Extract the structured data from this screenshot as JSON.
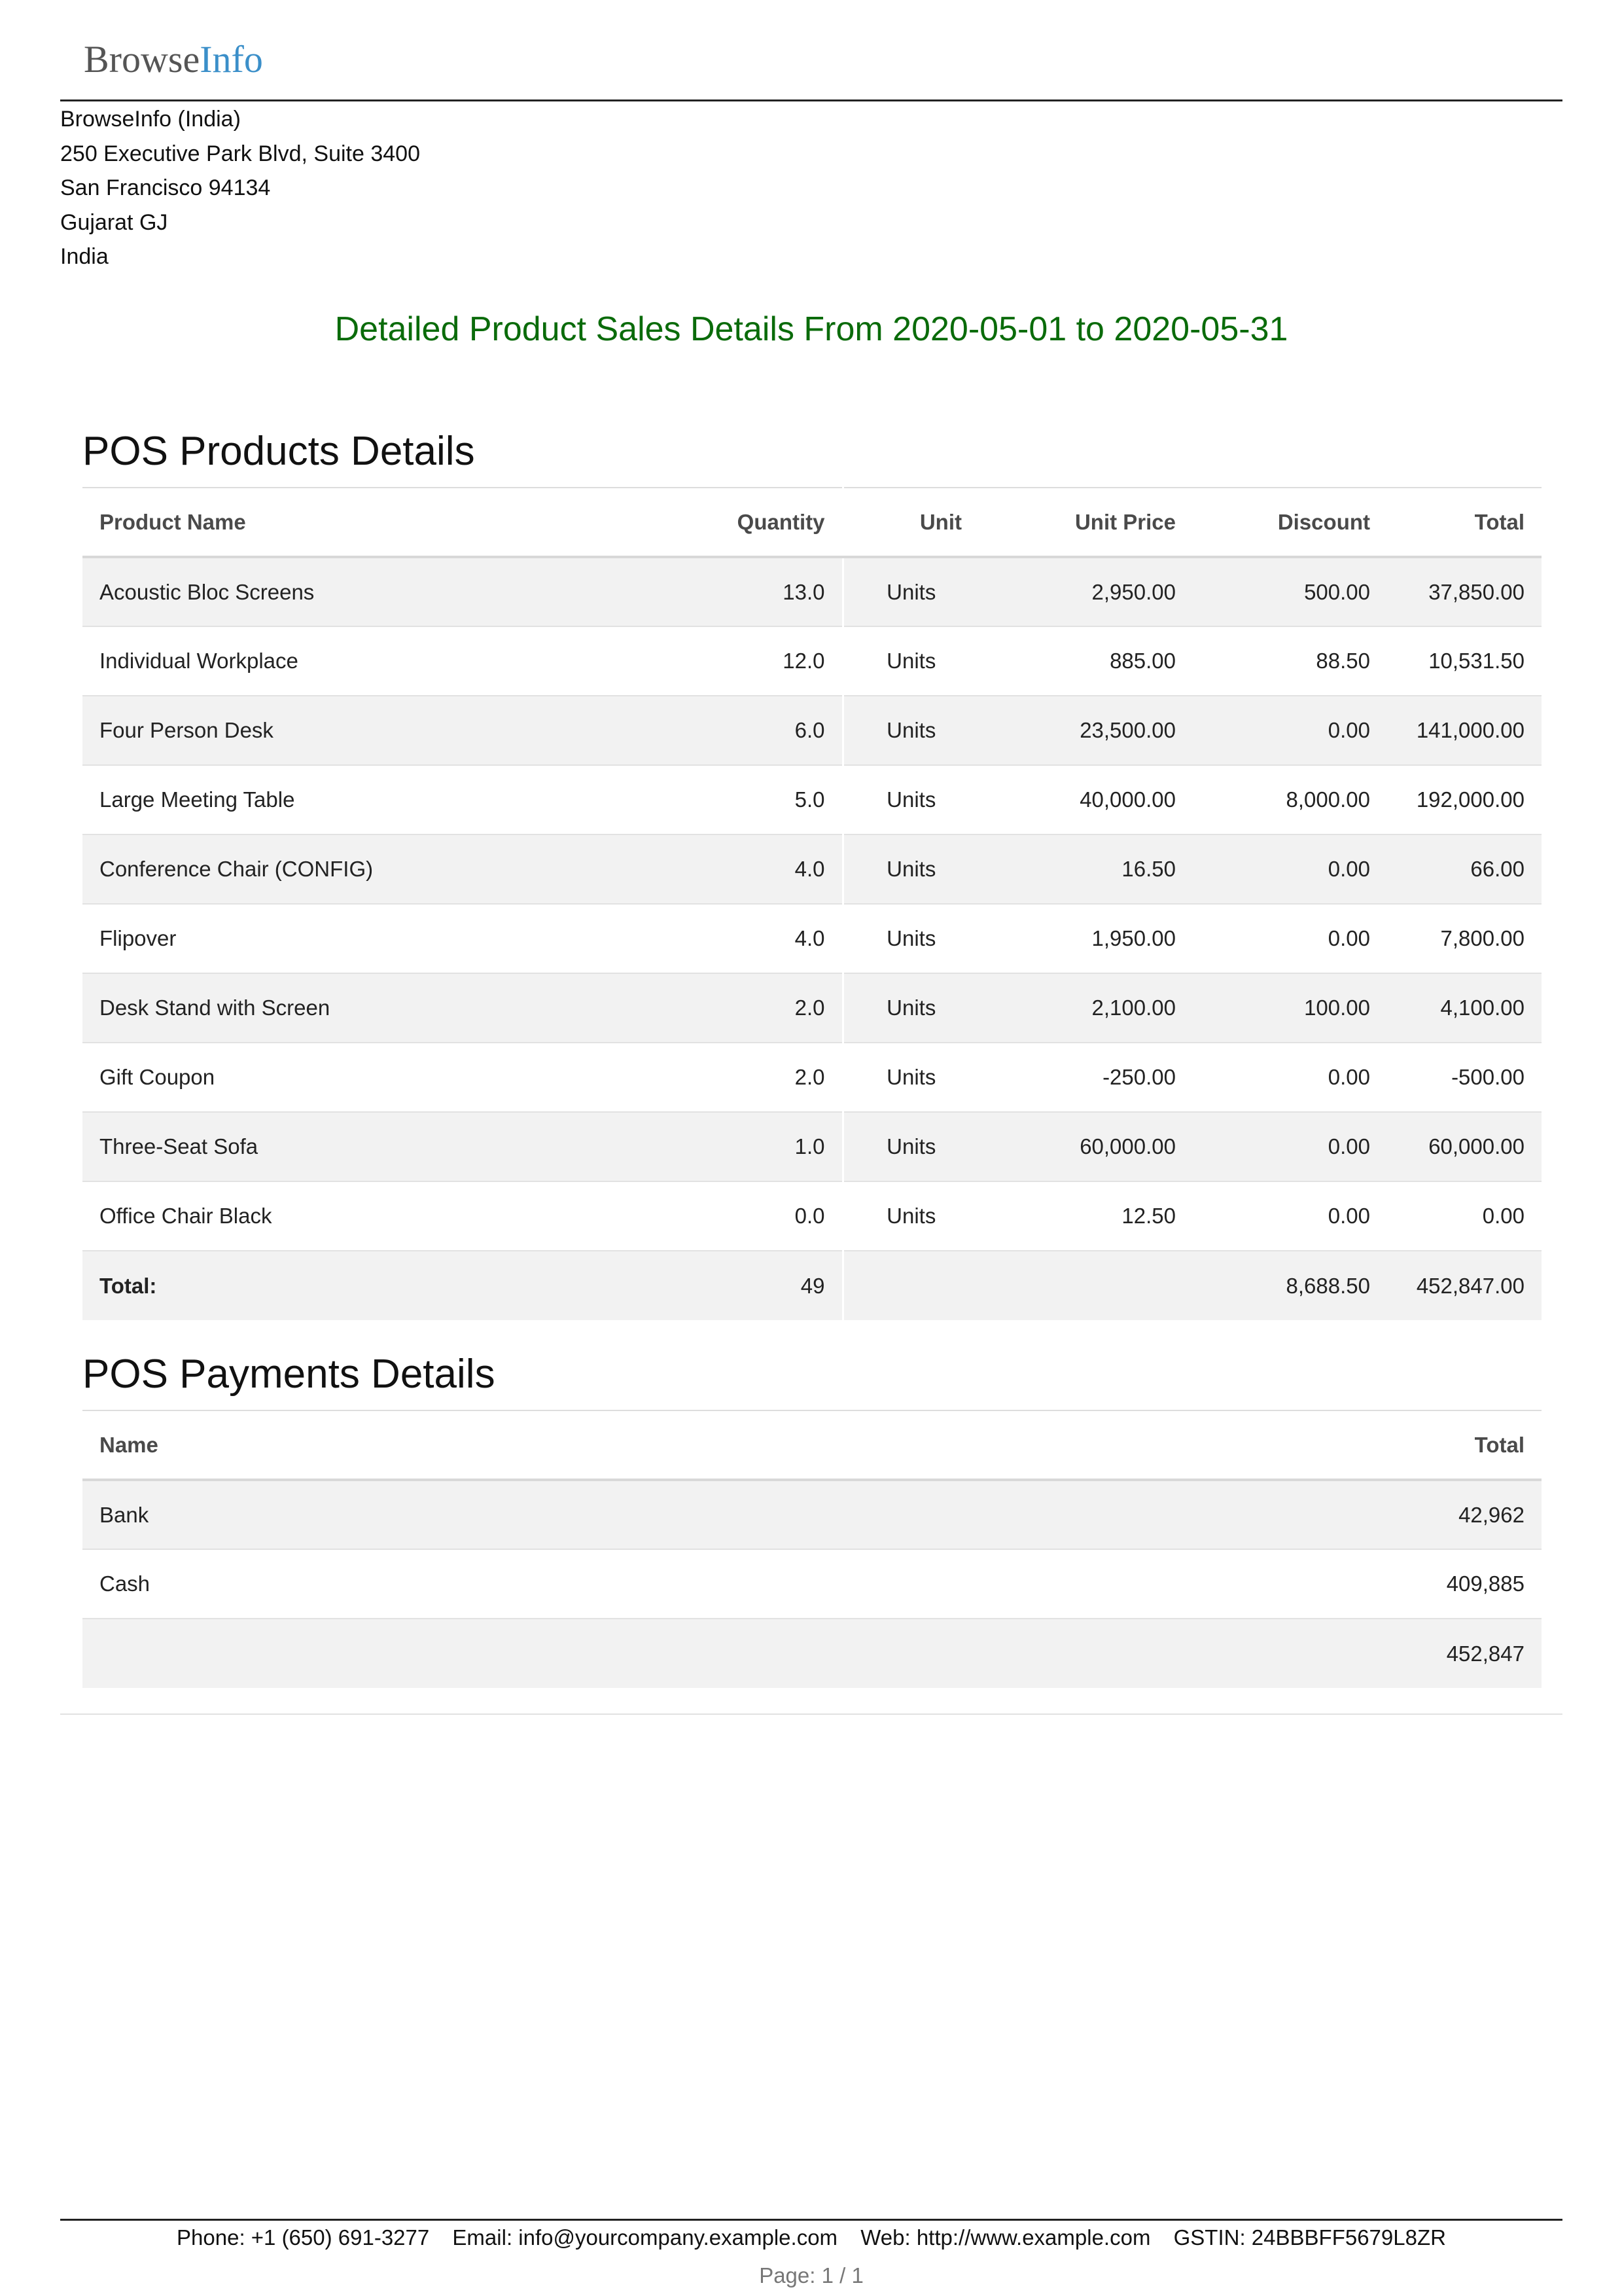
{
  "company": {
    "logo_part1": "Browse",
    "logo_part2": "Info",
    "address_lines": [
      "BrowseInfo (India)",
      "250 Executive Park Blvd, Suite 3400",
      "San Francisco 94134",
      "Gujarat GJ",
      "India"
    ]
  },
  "report": {
    "title": "Detailed Product Sales Details From 2020-05-01 to 2020-05-31"
  },
  "products": {
    "section_title": "POS Products Details",
    "columns": {
      "name": "Product Name",
      "quantity": "Quantity",
      "unit": "Unit",
      "unit_price": "Unit Price",
      "discount": "Discount",
      "total": "Total"
    },
    "rows": [
      {
        "name": "Acoustic Bloc Screens",
        "quantity": "13.0",
        "unit": "Units",
        "unit_price": "2,950.00",
        "discount": "500.00",
        "total": "37,850.00"
      },
      {
        "name": "Individual Workplace",
        "quantity": "12.0",
        "unit": "Units",
        "unit_price": "885.00",
        "discount": "88.50",
        "total": "10,531.50"
      },
      {
        "name": "Four Person Desk",
        "quantity": "6.0",
        "unit": "Units",
        "unit_price": "23,500.00",
        "discount": "0.00",
        "total": "141,000.00"
      },
      {
        "name": "Large Meeting Table",
        "quantity": "5.0",
        "unit": "Units",
        "unit_price": "40,000.00",
        "discount": "8,000.00",
        "total": "192,000.00"
      },
      {
        "name": "Conference Chair (CONFIG)",
        "quantity": "4.0",
        "unit": "Units",
        "unit_price": "16.50",
        "discount": "0.00",
        "total": "66.00"
      },
      {
        "name": "Flipover",
        "quantity": "4.0",
        "unit": "Units",
        "unit_price": "1,950.00",
        "discount": "0.00",
        "total": "7,800.00"
      },
      {
        "name": "Desk Stand with Screen",
        "quantity": "2.0",
        "unit": "Units",
        "unit_price": "2,100.00",
        "discount": "100.00",
        "total": "4,100.00"
      },
      {
        "name": "Gift Coupon",
        "quantity": "2.0",
        "unit": "Units",
        "unit_price": "-250.00",
        "discount": "0.00",
        "total": "-500.00"
      },
      {
        "name": "Three-Seat Sofa",
        "quantity": "1.0",
        "unit": "Units",
        "unit_price": "60,000.00",
        "discount": "0.00",
        "total": "60,000.00"
      },
      {
        "name": "Office Chair Black",
        "quantity": "0.0",
        "unit": "Units",
        "unit_price": "12.50",
        "discount": "0.00",
        "total": "0.00"
      }
    ],
    "totals": {
      "label": "Total:",
      "quantity": "49",
      "discount": "8,688.50",
      "total": "452,847.00"
    }
  },
  "payments": {
    "section_title": "POS Payments Details",
    "columns": {
      "name": "Name",
      "total": "Total"
    },
    "rows": [
      {
        "name": "Bank",
        "total": "42,962"
      },
      {
        "name": "Cash",
        "total": "409,885"
      },
      {
        "name": "",
        "total": "452,847"
      }
    ]
  },
  "footer": {
    "phone": "Phone: +1 (650) 691-3277",
    "email": "Email: info@yourcompany.example.com",
    "web": "Web: http://www.example.com",
    "gstin": "GSTIN: 24BBBFF5679L8ZR",
    "page": "Page: 1 / 1"
  }
}
